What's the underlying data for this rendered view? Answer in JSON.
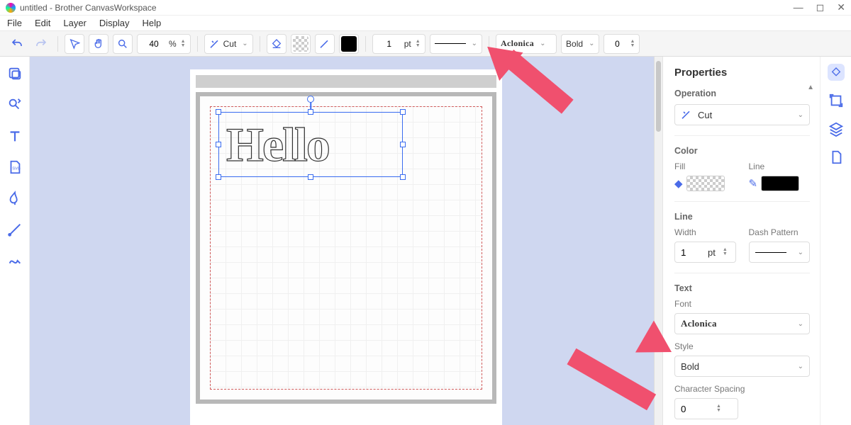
{
  "titlebar": {
    "title": "untitled - Brother CanvasWorkspace"
  },
  "menu": {
    "file": "File",
    "edit": "Edit",
    "layer": "Layer",
    "display": "Display",
    "help": "Help"
  },
  "toolbar": {
    "zoom_value": "40",
    "zoom_unit": "%",
    "operation_label": "Cut",
    "line_width_value": "1",
    "line_width_unit": "pt",
    "font_name": "Aclonica",
    "font_style": "Bold",
    "char_spacing": "0"
  },
  "canvas": {
    "text_content": "Hello"
  },
  "properties": {
    "title": "Properties",
    "operation_section": "Operation",
    "operation_value": "Cut",
    "color_section": "Color",
    "fill_label": "Fill",
    "line_label": "Line",
    "line_section": "Line",
    "width_label": "Width",
    "width_value": "1",
    "width_unit": "pt",
    "dash_label": "Dash Pattern",
    "text_section": "Text",
    "font_label": "Font",
    "font_value": "Aclonica",
    "style_label": "Style",
    "style_value": "Bold",
    "charspacing_label": "Character Spacing",
    "charspacing_value": "0"
  },
  "colors": {
    "accent": "#4a6be8",
    "arrow": "#f0506e"
  }
}
